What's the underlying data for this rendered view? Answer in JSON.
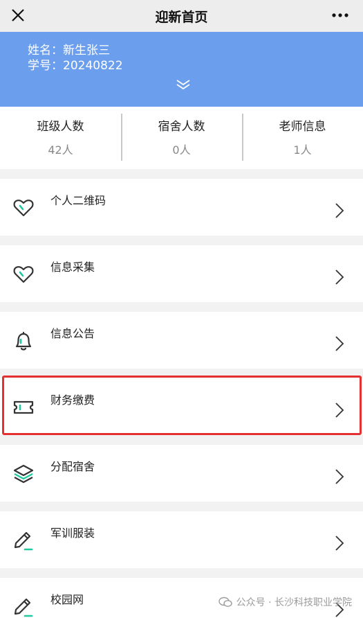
{
  "header": {
    "title": "迎新首页",
    "close_icon": "close-icon",
    "more_icon": "more-icon"
  },
  "profile": {
    "name_line": "姓名：新生张三",
    "id_line": "学号：20240822",
    "expand_icon": "double-chevron-down-icon"
  },
  "stats": [
    {
      "label": "班级人数",
      "value": "42人"
    },
    {
      "label": "宿舍人数",
      "value": "0人"
    },
    {
      "label": "老师信息",
      "value": "1人"
    }
  ],
  "menu": [
    {
      "label": "个人二维码",
      "icon": "heart-icon"
    },
    {
      "label": "信息采集",
      "icon": "heart-icon"
    },
    {
      "label": "信息公告",
      "icon": "bell-icon"
    },
    {
      "label": "财务缴费",
      "icon": "ticket-icon",
      "highlighted": true
    },
    {
      "label": "分配宿舍",
      "icon": "layers-icon"
    },
    {
      "label": "军训服装",
      "icon": "pencil-icon"
    },
    {
      "label": "校园网",
      "icon": "pencil-icon"
    }
  ],
  "watermark": {
    "text": "公众号 · 长沙科技职业学院",
    "icon": "wechat-icon"
  },
  "colors": {
    "banner": "#6b9eed",
    "accent": "#1ec9a0",
    "highlight_border": "#e43030"
  }
}
